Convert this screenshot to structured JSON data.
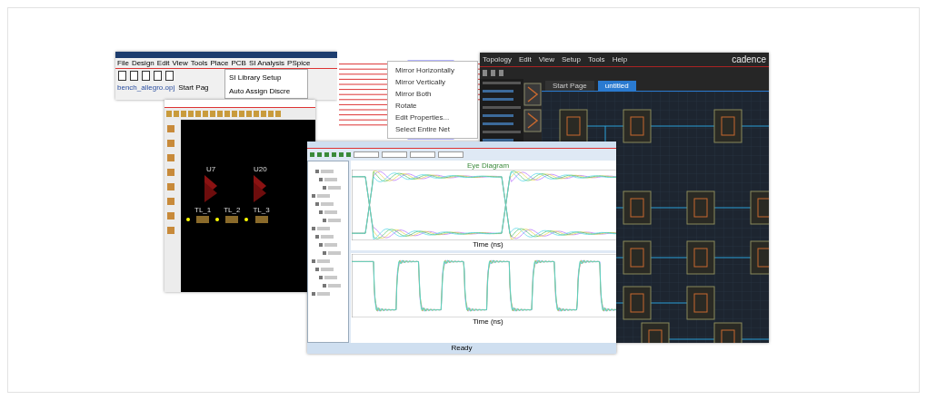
{
  "capture": {
    "menu": [
      "File",
      "Design",
      "Edit",
      "View",
      "Tools",
      "Place",
      "PCB",
      "SI Analysis",
      "PSpice"
    ],
    "project": "bench_allegro.opj",
    "tab": "Start Pag",
    "dropdown": [
      "SI Library Setup",
      "Auto Assign Discre"
    ]
  },
  "schematic": {
    "context_menu": [
      "Mirror Horizontally",
      "Mirror Vertically",
      "Mirror Both",
      "Rotate",
      "Edit Properties...",
      "Select Entire Net"
    ]
  },
  "pcb": {
    "parts": [
      {
        "name": "U7"
      },
      {
        "name": "U20"
      }
    ],
    "lines": [
      {
        "name": "TL_1"
      },
      {
        "name": "TL_2"
      },
      {
        "name": "TL_3"
      }
    ]
  },
  "topology": {
    "brand": "cadence",
    "menu": [
      "Topology",
      "Edit",
      "View",
      "Setup",
      "Tools",
      "Help"
    ],
    "tabs": [
      {
        "label": "Start Page",
        "selected": false
      },
      {
        "label": "untitled",
        "selected": true
      }
    ]
  },
  "sigwave": {
    "eye_title": "Eye Diagram",
    "upper_xlabel": "Time (ns)",
    "lower_xlabel": "Time (ns)",
    "status": "Ready"
  }
}
